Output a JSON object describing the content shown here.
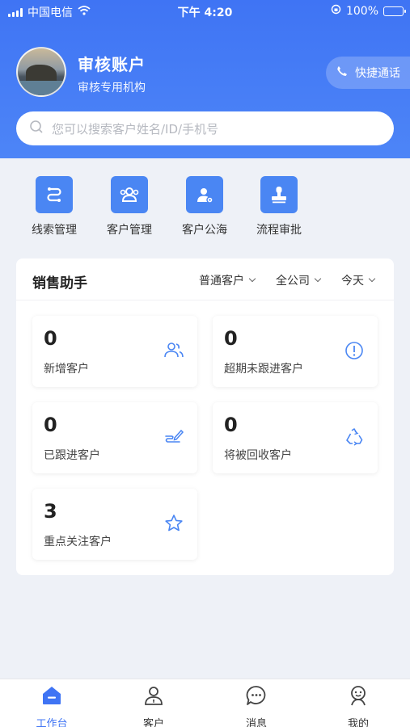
{
  "status_bar": {
    "carrier": "中国电信",
    "time": "下午 4:20",
    "battery": "100%"
  },
  "account": {
    "name": "审核账户",
    "org": "审核专用机构"
  },
  "quick_call": {
    "label": "快捷通话"
  },
  "search": {
    "placeholder": "您可以搜索客户姓名/ID/手机号"
  },
  "shortcuts": [
    {
      "label": "线索管理",
      "icon": "clue-icon"
    },
    {
      "label": "客户管理",
      "icon": "customers-icon"
    },
    {
      "label": "客户公海",
      "icon": "public-pool-icon"
    },
    {
      "label": "流程审批",
      "icon": "approval-stamp-icon"
    }
  ],
  "sales_assistant": {
    "title": "销售助手",
    "filters": [
      "普通客户",
      "全公司",
      "今天"
    ],
    "stats": [
      {
        "value": "0",
        "label": "新增客户",
        "icon": "users-icon"
      },
      {
        "value": "0",
        "label": "超期未跟进客户",
        "icon": "alert-circle-icon"
      },
      {
        "value": "0",
        "label": "已跟进客户",
        "icon": "follow-up-icon"
      },
      {
        "value": "0",
        "label": "将被回收客户",
        "icon": "recycle-icon"
      },
      {
        "value": "3",
        "label": "重点关注客户",
        "icon": "star-icon"
      }
    ]
  },
  "tabbar": [
    {
      "label": "工作台",
      "icon": "workbench-icon",
      "active": true
    },
    {
      "label": "客户",
      "icon": "customer-icon",
      "active": false
    },
    {
      "label": "消息",
      "icon": "message-icon",
      "active": false
    },
    {
      "label": "我的",
      "icon": "profile-icon",
      "active": false
    }
  ],
  "colors": {
    "primary": "#3f74f4",
    "icon_blue": "#4a86f3",
    "background": "#eef1f7"
  }
}
